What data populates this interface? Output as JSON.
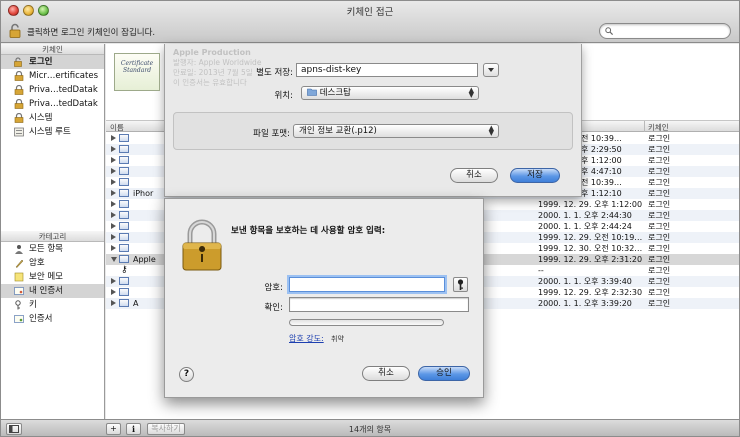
{
  "window": {
    "title": "키체인 접근",
    "lock_text": "클릭하면 로그인 키체인이 잠깁니다."
  },
  "sidebar": {
    "keychains_header": "키체인",
    "keychains": [
      {
        "label": "로그인",
        "icon": "lock-open-icon",
        "selected": true
      },
      {
        "label": "Micr…ertificates",
        "icon": "lock-icon"
      },
      {
        "label": "Priva…tedDatak",
        "icon": "lock-icon"
      },
      {
        "label": "Priva…tedDatak",
        "icon": "lock-icon"
      },
      {
        "label": "시스템",
        "icon": "lock-icon"
      },
      {
        "label": "시스템 루트",
        "icon": "cabinet-icon"
      }
    ],
    "categories_header": "카테고리",
    "categories": [
      {
        "label": "모든 항목",
        "icon": "people-icon"
      },
      {
        "label": "암호",
        "icon": "pen-icon"
      },
      {
        "label": "보안 메모",
        "icon": "note-icon"
      },
      {
        "label": "내 인증서",
        "icon": "cert-icon",
        "selected": true
      },
      {
        "label": "키",
        "icon": "key-icon"
      },
      {
        "label": "인증서",
        "icon": "cert-icon"
      }
    ]
  },
  "list": {
    "col_name": "이름",
    "col_keychain": "키체인",
    "rows": [
      {
        "name": "",
        "date": ". 12. 29. 오전 10:39…",
        "keychain": "로그인"
      },
      {
        "name": "",
        "date": ". 12. 29. 오후 2:29:50",
        "keychain": "로그인"
      },
      {
        "name": "",
        "date": ". 12. 29. 오후 1:12:00",
        "keychain": "로그인"
      },
      {
        "name": "",
        "date": ". 12. 28. 오후 4:47:10",
        "keychain": "로그인"
      },
      {
        "name": "",
        "date": ". 12. 29. 오전 10:39…",
        "keychain": "로그인"
      },
      {
        "name": "iPhor",
        "date": ". 12. 29. 오후 1:12:10",
        "keychain": "로그인"
      },
      {
        "name": "",
        "date": "1999. 12. 29. 오후 1:12:00",
        "keychain": "로그인"
      },
      {
        "name": "",
        "date": "2000. 1. 1. 오후 2:44:30",
        "keychain": "로그인"
      },
      {
        "name": "",
        "date": "2000. 1. 1. 오후 2:44:24",
        "keychain": "로그인"
      },
      {
        "name": "",
        "date": "1999. 12. 29. 오전 10:19…",
        "keychain": "로그인"
      },
      {
        "name": "",
        "date": "1999. 12. 30. 오전 10:32…",
        "keychain": "로그인"
      },
      {
        "name": "Apple",
        "date": "1999. 12. 29. 오후 2:31:20",
        "keychain": "로그인"
      },
      {
        "name": "",
        "date": "--",
        "keychain": "로그인"
      },
      {
        "name": "",
        "date": "2000. 1. 1. 오후 3:39:40",
        "keychain": "로그인"
      },
      {
        "name": "",
        "date": "1999. 12. 29. 오후 2:32:30",
        "keychain": "로그인"
      },
      {
        "name": "A",
        "date": "2000. 1. 1. 오후 3:39:20",
        "keychain": "로그인"
      }
    ]
  },
  "bottom": {
    "copy_label": "복사하기",
    "count": "14개의 항목"
  },
  "export_sheet": {
    "cert_thumb_text": "Certificate Standard",
    "bg_lines": [
      "Apple Production",
      "발행자: Apple Worldwide",
      "만료일: 2013년 7월 5일",
      "이 인증서는 유효합니다"
    ],
    "save_as_label": "별도 저장:",
    "save_as_value": "apns-dist-key",
    "where_label": "위치:",
    "where_value": "데스크탑",
    "format_label": "파일 포맷:",
    "format_value": "개인 정보 교환(.p12)",
    "cancel_label": "취소",
    "save_label": "저장"
  },
  "password_dialog": {
    "title": "보낸 항목을 보호하는 데 사용할 암호 입력:",
    "password_label": "암호:",
    "verify_label": "확인:",
    "strength_label": "암호 강도:",
    "strength_value": "취약",
    "strength_level": 0,
    "help_label": "?",
    "cancel_label": "취소",
    "ok_label": "승인"
  }
}
